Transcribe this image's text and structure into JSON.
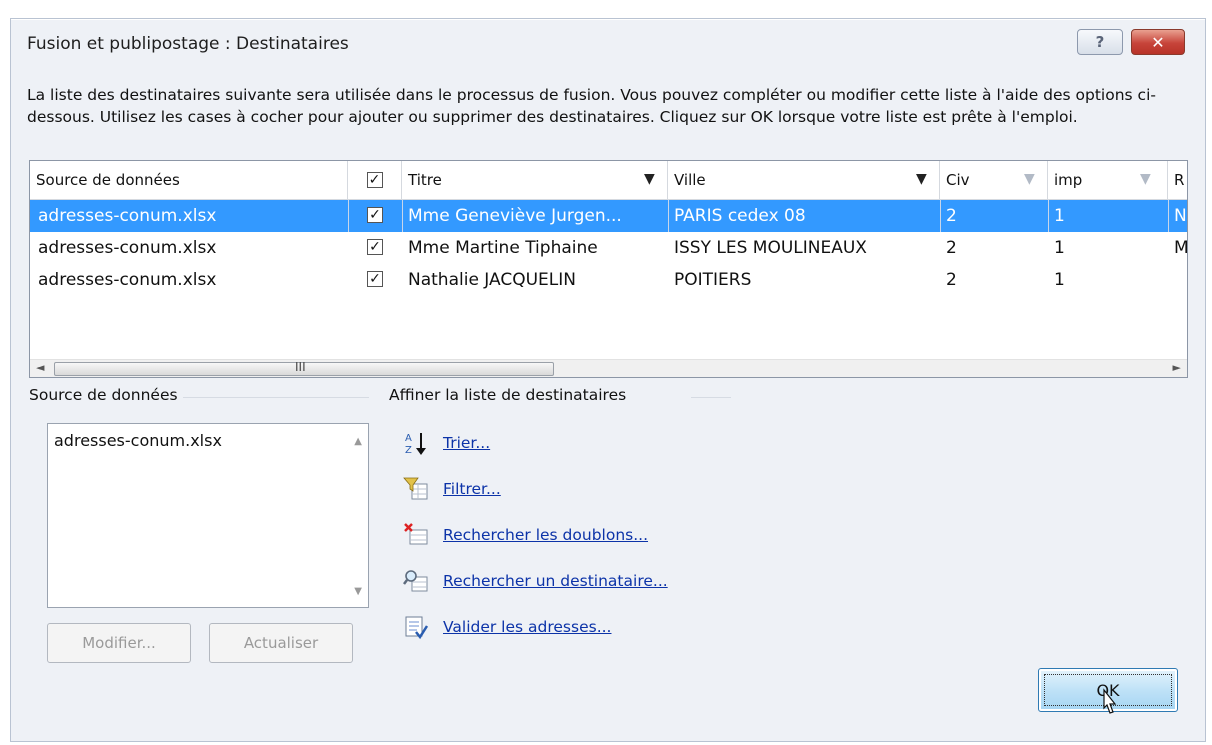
{
  "window": {
    "title": "Fusion et publipostage : Destinataires",
    "help_glyph": "?",
    "close_glyph": "✕"
  },
  "intro_text": "La liste des destinataires suivante sera utilisée dans le processus de fusion. Vous pouvez compléter ou modifier cette liste à l'aide des options ci-dessous. Utilisez les cases à cocher pour ajouter ou supprimer des destinataires. Cliquez sur OK lorsque votre liste est prête à l'emploi.",
  "grid": {
    "columns": [
      "Source de données",
      "",
      "Titre",
      "Ville",
      "Civ",
      "imp",
      "R"
    ],
    "header_checkbox": "✓",
    "rows": [
      {
        "source": "adresses-conum.xlsx",
        "check": "✓",
        "titre": "Mme Geneviève Jurgen...",
        "ville": "PARIS cedex 08",
        "civ": "2",
        "imp": "1",
        "r": "N"
      },
      {
        "source": "adresses-conum.xlsx",
        "check": "✓",
        "titre": "Mme Martine Tiphaine",
        "ville": "ISSY LES MOULINEAUX",
        "civ": "2",
        "imp": "1",
        "r": "M"
      },
      {
        "source": "adresses-conum.xlsx",
        "check": "✓",
        "titre": "Nathalie JACQUELIN",
        "ville": "POITIERS",
        "civ": "2",
        "imp": "1",
        "r": ""
      }
    ],
    "scroll_left": "◄",
    "scroll_right": "►",
    "scroll_grip": "III"
  },
  "data_source_panel": {
    "label": "Source de données",
    "items": [
      "adresses-conum.xlsx"
    ],
    "modify_label": "Modifier...",
    "refresh_label": "Actualiser"
  },
  "refine_panel": {
    "label": "Affiner la liste de destinataires",
    "actions": [
      {
        "label": "Trier...",
        "icon": "sort-az-icon"
      },
      {
        "label": "Filtrer...",
        "icon": "filter-icon"
      },
      {
        "label": "Rechercher les doublons...",
        "icon": "find-duplicates-icon"
      },
      {
        "label": "Rechercher un destinataire...",
        "icon": "find-recipient-icon"
      },
      {
        "label": "Valider les adresses...",
        "icon": "validate-addresses-icon"
      }
    ]
  },
  "ok_label": "OK"
}
